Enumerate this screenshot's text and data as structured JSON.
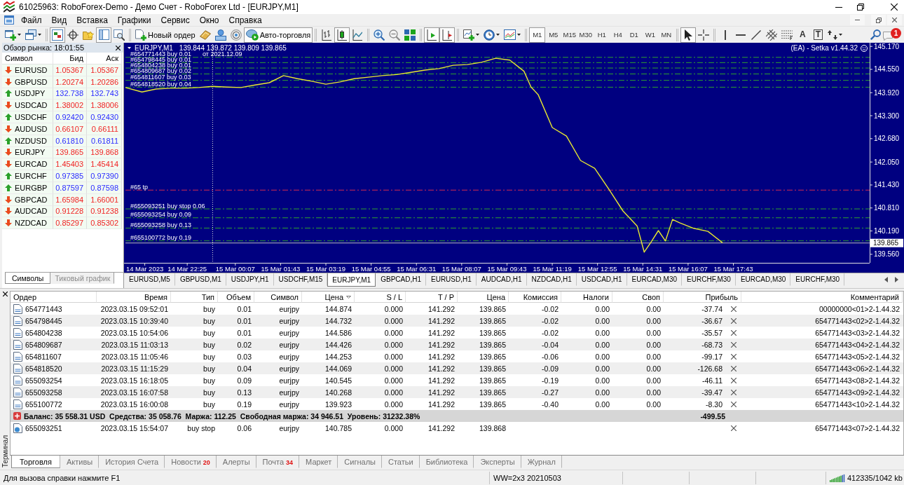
{
  "window": {
    "title": "61025963: RoboForex-Demo - Демо Счет - RoboForex Ltd - [EURJPY,M1]"
  },
  "menu": [
    "Файл",
    "Вид",
    "Вставка",
    "Графики",
    "Сервис",
    "Окно",
    "Справка"
  ],
  "toolbar": {
    "view_buttons": [
      {
        "pressed": true
      },
      {
        "pressed": false
      },
      {
        "pressed": false
      },
      {
        "pressed": true
      },
      {
        "pressed": false
      }
    ],
    "new_order": "Новый ордер",
    "auto_trading": {
      "label": "Авто-торговля",
      "on": true
    },
    "chart_modes": [
      {
        "selected": false
      },
      {
        "selected": true
      },
      {
        "selected": false
      }
    ],
    "chart_toggles": [
      {
        "pressed": true
      },
      {
        "pressed": true
      }
    ],
    "timeframes": [
      {
        "label": "M1",
        "selected": true
      },
      {
        "label": "M5",
        "selected": false
      },
      {
        "label": "M15",
        "selected": false
      },
      {
        "label": "M30",
        "selected": false
      },
      {
        "label": "H1",
        "selected": false
      },
      {
        "label": "H4",
        "selected": false
      },
      {
        "label": "D1",
        "selected": false
      },
      {
        "label": "W1",
        "selected": false
      },
      {
        "label": "MN",
        "selected": false
      }
    ],
    "drawing_tools": [
      {
        "kind": "icon",
        "selected": true
      },
      {
        "kind": "icon",
        "selected": false
      },
      {
        "kind": "icon",
        "selected": false
      },
      {
        "kind": "icon",
        "selected": false
      },
      {
        "kind": "icon",
        "selected": false
      },
      {
        "kind": "icon",
        "selected": false
      },
      {
        "kind": "icon",
        "selected": false
      },
      {
        "kind": "glyph",
        "glyph": "A",
        "framed": false,
        "selected": false
      },
      {
        "kind": "glyph",
        "glyph": "T",
        "framed": true,
        "selected": false
      },
      {
        "kind": "icon",
        "selected": false
      }
    ],
    "notifications": {
      "badge": "1"
    }
  },
  "market_watch": {
    "title": "Обзор рынка: 18:01:55",
    "columns": [
      "Символ",
      "Бид",
      "Аск"
    ],
    "rows": [
      {
        "symbol": "EURUSD",
        "bid": "1.05367",
        "ask": "1.05367",
        "rising": false
      },
      {
        "symbol": "GBPUSD",
        "bid": "1.20274",
        "ask": "1.20286",
        "rising": false
      },
      {
        "symbol": "USDJPY",
        "bid": "132.738",
        "ask": "132.743",
        "rising": true
      },
      {
        "symbol": "USDCAD",
        "bid": "1.38002",
        "ask": "1.38006",
        "rising": false
      },
      {
        "symbol": "USDCHF",
        "bid": "0.92420",
        "ask": "0.92430",
        "rising": true
      },
      {
        "symbol": "AUDUSD",
        "bid": "0.66107",
        "ask": "0.66111",
        "rising": false
      },
      {
        "symbol": "NZDUSD",
        "bid": "0.61810",
        "ask": "0.61811",
        "rising": true
      },
      {
        "symbol": "EURJPY",
        "bid": "139.865",
        "ask": "139.868",
        "rising": false
      },
      {
        "symbol": "EURCAD",
        "bid": "1.45403",
        "ask": "1.45414",
        "rising": false
      },
      {
        "symbol": "EURCHF",
        "bid": "0.97385",
        "ask": "0.97390",
        "rising": true
      },
      {
        "symbol": "EURGBP",
        "bid": "0.87597",
        "ask": "0.87598",
        "rising": true
      },
      {
        "symbol": "GBPCAD",
        "bid": "1.65984",
        "ask": "1.66001",
        "rising": false
      },
      {
        "symbol": "AUDCAD",
        "bid": "0.91228",
        "ask": "0.91238",
        "rising": false
      },
      {
        "symbol": "NZDCAD",
        "bid": "0.85297",
        "ask": "0.85302",
        "rising": false
      }
    ],
    "tabs": [
      {
        "label": "Символы",
        "selected": true
      },
      {
        "label": "Тиковый график",
        "selected": false
      }
    ]
  },
  "chart": {
    "symbol": "EURJPY,M1",
    "ohlc": "139.844 139.872 139.809 139.865",
    "expert": "(EA) - Setka v1.44.32",
    "chart_data": [
      {
        "type": "line",
        "color": "#e8e830",
        "x": [
          "2023-03-14T20:14",
          "2023-03-14T20:49",
          "2023-03-14T21:19",
          "2023-03-14T21:49",
          "2023-03-14T22:19",
          "2023-03-14T22:49",
          "2023-03-14T23:19",
          "2023-03-14T23:49",
          "2023-03-15T00:19",
          "2023-03-15T00:49",
          "2023-03-15T01:19",
          "2023-03-15T01:49",
          "2023-03-15T02:19",
          "2023-03-15T02:49",
          "2023-03-15T03:19",
          "2023-03-15T03:49",
          "2023-03-15T04:19",
          "2023-03-15T04:49",
          "2023-03-15T05:19",
          "2023-03-15T05:49",
          "2023-03-15T06:19",
          "2023-03-15T06:49",
          "2023-03-15T07:19",
          "2023-03-15T07:49",
          "2023-03-15T08:19",
          "2023-03-15T08:49",
          "2023-03-15T09:19",
          "2023-03-15T09:49",
          "2023-03-15T10:19",
          "2023-03-15T10:34",
          "2023-03-15T10:49",
          "2023-03-15T11:19",
          "2023-03-15T11:49",
          "2023-03-15T12:19",
          "2023-03-15T12:49",
          "2023-03-15T13:19",
          "2023-03-15T13:49",
          "2023-03-15T14:19",
          "2023-03-15T14:34",
          "2023-03-15T14:49",
          "2023-03-15T15:04",
          "2023-03-15T15:19",
          "2023-03-15T15:34",
          "2023-03-15T15:49",
          "2023-03-15T16:19",
          "2023-03-15T16:49",
          "2023-03-15T17:20"
        ],
        "values": [
          144.06,
          143.94,
          144.02,
          144.04,
          144.04,
          144.06,
          144.09,
          144.07,
          144.06,
          144.13,
          144.19,
          144.38,
          144.3,
          144.23,
          144.15,
          144.21,
          144.3,
          144.34,
          144.38,
          144.41,
          144.47,
          144.53,
          144.57,
          144.66,
          144.68,
          144.74,
          144.85,
          144.8,
          144.5,
          144.07,
          143.87,
          142.98,
          142.75,
          142.09,
          141.88,
          141.32,
          140.73,
          140.32,
          139.62,
          139.9,
          140.2,
          139.92,
          140.5,
          140.41,
          140.26,
          140.18,
          139.87
        ],
        "xlim": [
          "2023-03-14T20:14",
          "2023-03-15T22:32"
        ],
        "ylim": [
          139.33,
          145.23
        ],
        "xticks": [
          {
            "value": "2023-03-14T20:55",
            "label": "14 Mar 2023"
          },
          {
            "value": "2023-03-14T22:25",
            "label": "14 Mar 22:25"
          },
          {
            "value": "2023-03-15T00:07",
            "label": "15 Mar 00:07"
          },
          {
            "value": "2023-03-15T01:43",
            "label": "15 Mar 01:43"
          },
          {
            "value": "2023-03-15T03:19",
            "label": "15 Mar 03:19"
          },
          {
            "value": "2023-03-15T04:55",
            "label": "15 Mar 04:55"
          },
          {
            "value": "2023-03-15T06:31",
            "label": "15 Mar 06:31"
          },
          {
            "value": "2023-03-15T08:07",
            "label": "15 Mar 08:07"
          },
          {
            "value": "2023-03-15T09:43",
            "label": "15 Mar 09:43"
          },
          {
            "value": "2023-03-15T11:19",
            "label": "15 Mar 11:19"
          },
          {
            "value": "2023-03-15T12:55",
            "label": "15 Mar 12:55"
          },
          {
            "value": "2023-03-15T14:31",
            "label": "15 Mar 14:31"
          },
          {
            "value": "2023-03-15T16:07",
            "label": "15 Mar 16:07"
          },
          {
            "value": "2023-03-15T17:43",
            "label": "15 Mar 17:43"
          }
        ],
        "yticks": [
          {
            "value": 145.17,
            "label": "145.170"
          },
          {
            "value": 144.55,
            "label": "144.550"
          },
          {
            "value": 143.92,
            "label": "143.920"
          },
          {
            "value": 143.3,
            "label": "143.300"
          },
          {
            "value": 142.68,
            "label": "142.680"
          },
          {
            "value": 142.05,
            "label": "142.050"
          },
          {
            "value": 141.43,
            "label": "141.430"
          },
          {
            "value": 140.81,
            "label": "140.810"
          },
          {
            "value": 140.19,
            "label": "140.190"
          },
          {
            "value": 139.56,
            "label": "139.560"
          }
        ],
        "ref_lines": [
          {
            "axis": "y",
            "value": 144.874,
            "label": "#654771443 buy 0.01",
            "color": "#2ea02e",
            "line_style": "dashdot"
          },
          {
            "axis": "y",
            "value": 144.732,
            "label": "#654798445 buy 0.01",
            "color": "#2ea02e",
            "line_style": "dashdot"
          },
          {
            "axis": "y",
            "value": 144.586,
            "label": "#654804238 buy 0.01",
            "color": "#2ea02e",
            "line_style": "dashdot"
          },
          {
            "axis": "y",
            "value": 144.426,
            "label": "#654809687 buy 0.02",
            "color": "#2ea02e",
            "line_style": "dashdot"
          },
          {
            "axis": "y",
            "value": 144.253,
            "label": "#654811607 buy 0.03",
            "color": "#2ea02e",
            "line_style": "dashdot"
          },
          {
            "axis": "y",
            "value": 144.069,
            "label": "#654818520 buy 0.04",
            "color": "#2ea02e",
            "line_style": "dashdot"
          },
          {
            "axis": "y",
            "value": 141.292,
            "label": "#65 tp",
            "color": "#d02850",
            "line_style": "dashdot"
          },
          {
            "axis": "y",
            "value": 140.785,
            "label": "#655093251 buy stop 0.06",
            "color": "#2ea02e",
            "line_style": "dashdot"
          },
          {
            "axis": "y",
            "value": 140.545,
            "label": "#655093254 buy 0.09",
            "color": "#2ea02e",
            "line_style": "dashdot"
          },
          {
            "axis": "y",
            "value": 140.268,
            "label": "#655093258 buy 0.13",
            "color": "#2ea02e",
            "line_style": "dashdot"
          },
          {
            "axis": "y",
            "value": 139.923,
            "label": "#655100772 buy 0.19",
            "color": "#2ea02e",
            "line_style": "dashdot"
          },
          {
            "axis": "y",
            "value": 139.865,
            "label": "139.865",
            "color": "#b8b8b8",
            "line_style": "solid"
          },
          {
            "axis": "x",
            "value": "2023-03-14T23:19",
            "color": "#d8d8d8",
            "line_style": "dotted"
          }
        ],
        "annotations": [
          "от 2021.12.09"
        ]
      }
    ]
  },
  "chart_tabs": [
    {
      "label": "EURUSD,M5",
      "selected": false
    },
    {
      "label": "GBPUSD,M1",
      "selected": false
    },
    {
      "label": "USDJPY,H1",
      "selected": false
    },
    {
      "label": "USDCHF,M15",
      "selected": false
    },
    {
      "label": "EURJPY,M1",
      "selected": true
    },
    {
      "label": "GBPCAD,H1",
      "selected": false
    },
    {
      "label": "EURUSD,H1",
      "selected": false
    },
    {
      "label": "AUDCAD,H1",
      "selected": false
    },
    {
      "label": "NZDCAD,H1",
      "selected": false
    },
    {
      "label": "USDCAD,H1",
      "selected": false
    },
    {
      "label": "EURCAD,M30",
      "selected": false
    },
    {
      "label": "EURCHF,M30",
      "selected": false
    },
    {
      "label": "EURCAD,M30",
      "selected": false
    },
    {
      "label": "EURCHF,M30",
      "selected": false
    }
  ],
  "terminal": {
    "side_label": "Терминал",
    "columns": [
      {
        "label": "Ордер",
        "sorted": false
      },
      {
        "label": "Время",
        "sorted": false
      },
      {
        "label": "Тип",
        "sorted": false
      },
      {
        "label": "Объем",
        "sorted": false
      },
      {
        "label": "Символ",
        "sorted": false
      },
      {
        "label": "Цена",
        "sorted": true
      },
      {
        "label": "S / L",
        "sorted": false
      },
      {
        "label": "T / P",
        "sorted": false
      },
      {
        "label": "Цена",
        "sorted": false
      },
      {
        "label": "Комиссия",
        "sorted": false
      },
      {
        "label": "Налоги",
        "sorted": false
      },
      {
        "label": "Своп",
        "sorted": false
      },
      {
        "label": "Прибыль",
        "sorted": false
      },
      {
        "label": "Комментарий",
        "sorted": false
      }
    ],
    "rows": [
      {
        "kind": "trade",
        "order": "654771443",
        "time": "2023.03.15 09:52:01",
        "type": "buy",
        "volume": "0.01",
        "symbol": "eurjpy",
        "price": "144.874",
        "sl": "0.000",
        "tp": "141.292",
        "current_price": "139.865",
        "commission": "-0.02",
        "taxes": "0.00",
        "swap": "0.00",
        "profit": "-37.74",
        "comment": "00000000<01>2-1.44.32"
      },
      {
        "kind": "trade",
        "order": "654798445",
        "time": "2023.03.15 10:39:40",
        "type": "buy",
        "volume": "0.01",
        "symbol": "eurjpy",
        "price": "144.732",
        "sl": "0.000",
        "tp": "141.292",
        "current_price": "139.865",
        "commission": "-0.02",
        "taxes": "0.00",
        "swap": "0.00",
        "profit": "-36.67",
        "comment": "654771443<02>2-1.44.32"
      },
      {
        "kind": "trade",
        "order": "654804238",
        "time": "2023.03.15 10:54:06",
        "type": "buy",
        "volume": "0.01",
        "symbol": "eurjpy",
        "price": "144.586",
        "sl": "0.000",
        "tp": "141.292",
        "current_price": "139.865",
        "commission": "-0.02",
        "taxes": "0.00",
        "swap": "0.00",
        "profit": "-35.57",
        "comment": "654771443<03>2-1.44.32"
      },
      {
        "kind": "trade",
        "order": "654809687",
        "time": "2023.03.15 11:03:13",
        "type": "buy",
        "volume": "0.02",
        "symbol": "eurjpy",
        "price": "144.426",
        "sl": "0.000",
        "tp": "141.292",
        "current_price": "139.865",
        "commission": "-0.04",
        "taxes": "0.00",
        "swap": "0.00",
        "profit": "-68.73",
        "comment": "654771443<04>2-1.44.32"
      },
      {
        "kind": "trade",
        "order": "654811607",
        "time": "2023.03.15 11:05:46",
        "type": "buy",
        "volume": "0.03",
        "symbol": "eurjpy",
        "price": "144.253",
        "sl": "0.000",
        "tp": "141.292",
        "current_price": "139.865",
        "commission": "-0.06",
        "taxes": "0.00",
        "swap": "0.00",
        "profit": "-99.17",
        "comment": "654771443<05>2-1.44.32"
      },
      {
        "kind": "trade",
        "order": "654818520",
        "time": "2023.03.15 11:15:29",
        "type": "buy",
        "volume": "0.04",
        "symbol": "eurjpy",
        "price": "144.069",
        "sl": "0.000",
        "tp": "141.292",
        "current_price": "139.865",
        "commission": "-0.09",
        "taxes": "0.00",
        "swap": "0.00",
        "profit": "-126.68",
        "comment": "654771443<06>2-1.44.32"
      },
      {
        "kind": "trade",
        "order": "655093254",
        "time": "2023.03.15 16:18:05",
        "type": "buy",
        "volume": "0.09",
        "symbol": "eurjpy",
        "price": "140.545",
        "sl": "0.000",
        "tp": "141.292",
        "current_price": "139.865",
        "commission": "-0.19",
        "taxes": "0.00",
        "swap": "0.00",
        "profit": "-46.11",
        "comment": "654771443<08>2-1.44.32"
      },
      {
        "kind": "trade",
        "order": "655093258",
        "time": "2023.03.15 16:07:58",
        "type": "buy",
        "volume": "0.13",
        "symbol": "eurjpy",
        "price": "140.268",
        "sl": "0.000",
        "tp": "141.292",
        "current_price": "139.865",
        "commission": "-0.27",
        "taxes": "0.00",
        "swap": "0.00",
        "profit": "-39.47",
        "comment": "654771443<09>2-1.44.32"
      },
      {
        "kind": "trade",
        "order": "655100772",
        "time": "2023.03.15 16:00:08",
        "type": "buy",
        "volume": "0.19",
        "symbol": "eurjpy",
        "price": "139.923",
        "sl": "0.000",
        "tp": "141.292",
        "current_price": "139.865",
        "commission": "-0.40",
        "taxes": "0.00",
        "swap": "0.00",
        "profit": "-8.30",
        "comment": "654771443<10>2-1.44.32"
      },
      {
        "kind": "summary",
        "text": "Баланс: 35 558.31 USD  Средства: 35 058.76  Маржа: 112.25  Свободная маржа: 34 946.51  Уровень: 31232.38%",
        "profit": "-499.55"
      },
      {
        "kind": "pending",
        "order": "655093251",
        "time": "2023.03.15 15:54:07",
        "type": "buy stop",
        "volume": "0.06",
        "symbol": "eurjpy",
        "price": "140.785",
        "sl": "0.000",
        "tp": "141.292",
        "current_price": "139.868",
        "comment": "654771443<07>2-1.44.32"
      }
    ],
    "tabs": [
      {
        "label": "Торговля",
        "selected": true
      },
      {
        "label": "Активы",
        "selected": false
      },
      {
        "label": "История Счета",
        "selected": false
      },
      {
        "label": "Новости",
        "badge": "20",
        "selected": false
      },
      {
        "label": "Алерты",
        "selected": false
      },
      {
        "label": "Почта",
        "badge": "34",
        "selected": false
      },
      {
        "label": "Маркет",
        "selected": false
      },
      {
        "label": "Сигналы",
        "selected": false
      },
      {
        "label": "Статьи",
        "selected": false
      },
      {
        "label": "Библиотека",
        "selected": false
      },
      {
        "label": "Эксперты",
        "selected": false
      },
      {
        "label": "Журнал",
        "selected": false
      }
    ]
  },
  "status_bar": {
    "help": "Для вызова справки нажмите F1",
    "profile": "WW=2x3 20210503",
    "traffic": "412335/1042 kb"
  }
}
